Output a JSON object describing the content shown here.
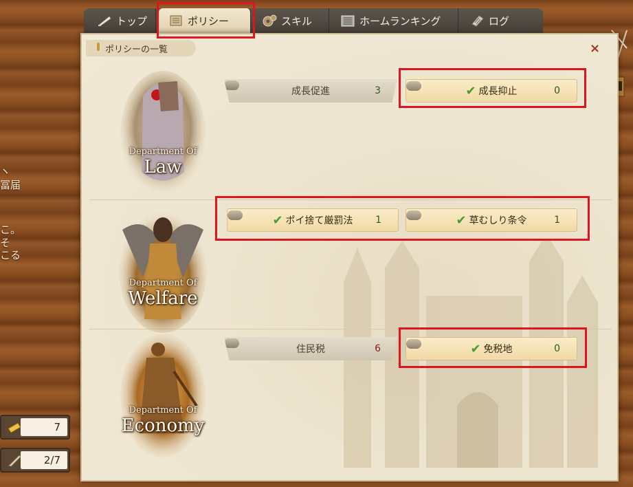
{
  "tabs": [
    {
      "label": "トップ",
      "icon": "quill-icon"
    },
    {
      "label": "ポリシー",
      "icon": "scroll-icon"
    },
    {
      "label": "スキル",
      "icon": "gear-icon"
    },
    {
      "label": "ホームランキング",
      "icon": "book-icon"
    },
    {
      "label": "ログ",
      "icon": "log-icon"
    }
  ],
  "panel": {
    "title": "ポリシーの一覧",
    "close": "×"
  },
  "departments": [
    {
      "sub": "Department Of",
      "name": "Law"
    },
    {
      "sub": "Department Of",
      "name": "Welfare"
    },
    {
      "sub": "Department Of",
      "name": "Economy"
    }
  ],
  "policies": {
    "law": [
      {
        "label": "成長促進",
        "count": "3",
        "active": false
      },
      {
        "label": "成長抑止",
        "count": "0",
        "active": true
      }
    ],
    "welfare": [
      {
        "label": "ポイ捨て厳罰法",
        "count": "1",
        "active": true
      },
      {
        "label": "草むしり条令",
        "count": "1",
        "active": true
      }
    ],
    "economy": [
      {
        "label": "住民税",
        "count": "6",
        "active": false
      },
      {
        "label": "免税地",
        "count": "0",
        "active": true
      }
    ]
  },
  "side": {
    "frag1": "ヽ",
    "frag2": "冨届",
    "frag3": "こ。",
    "frag4": "そ",
    "frag5": "こる"
  },
  "counters": [
    {
      "icon": "ticket-icon",
      "value": "7"
    },
    {
      "icon": "quill-scroll-icon",
      "value": "2/7"
    }
  ],
  "colors": {
    "highlight": "#e0141e",
    "check": "#4a9a36",
    "count_green": "#2e5a1e",
    "count_red": "#8b1a1a"
  }
}
